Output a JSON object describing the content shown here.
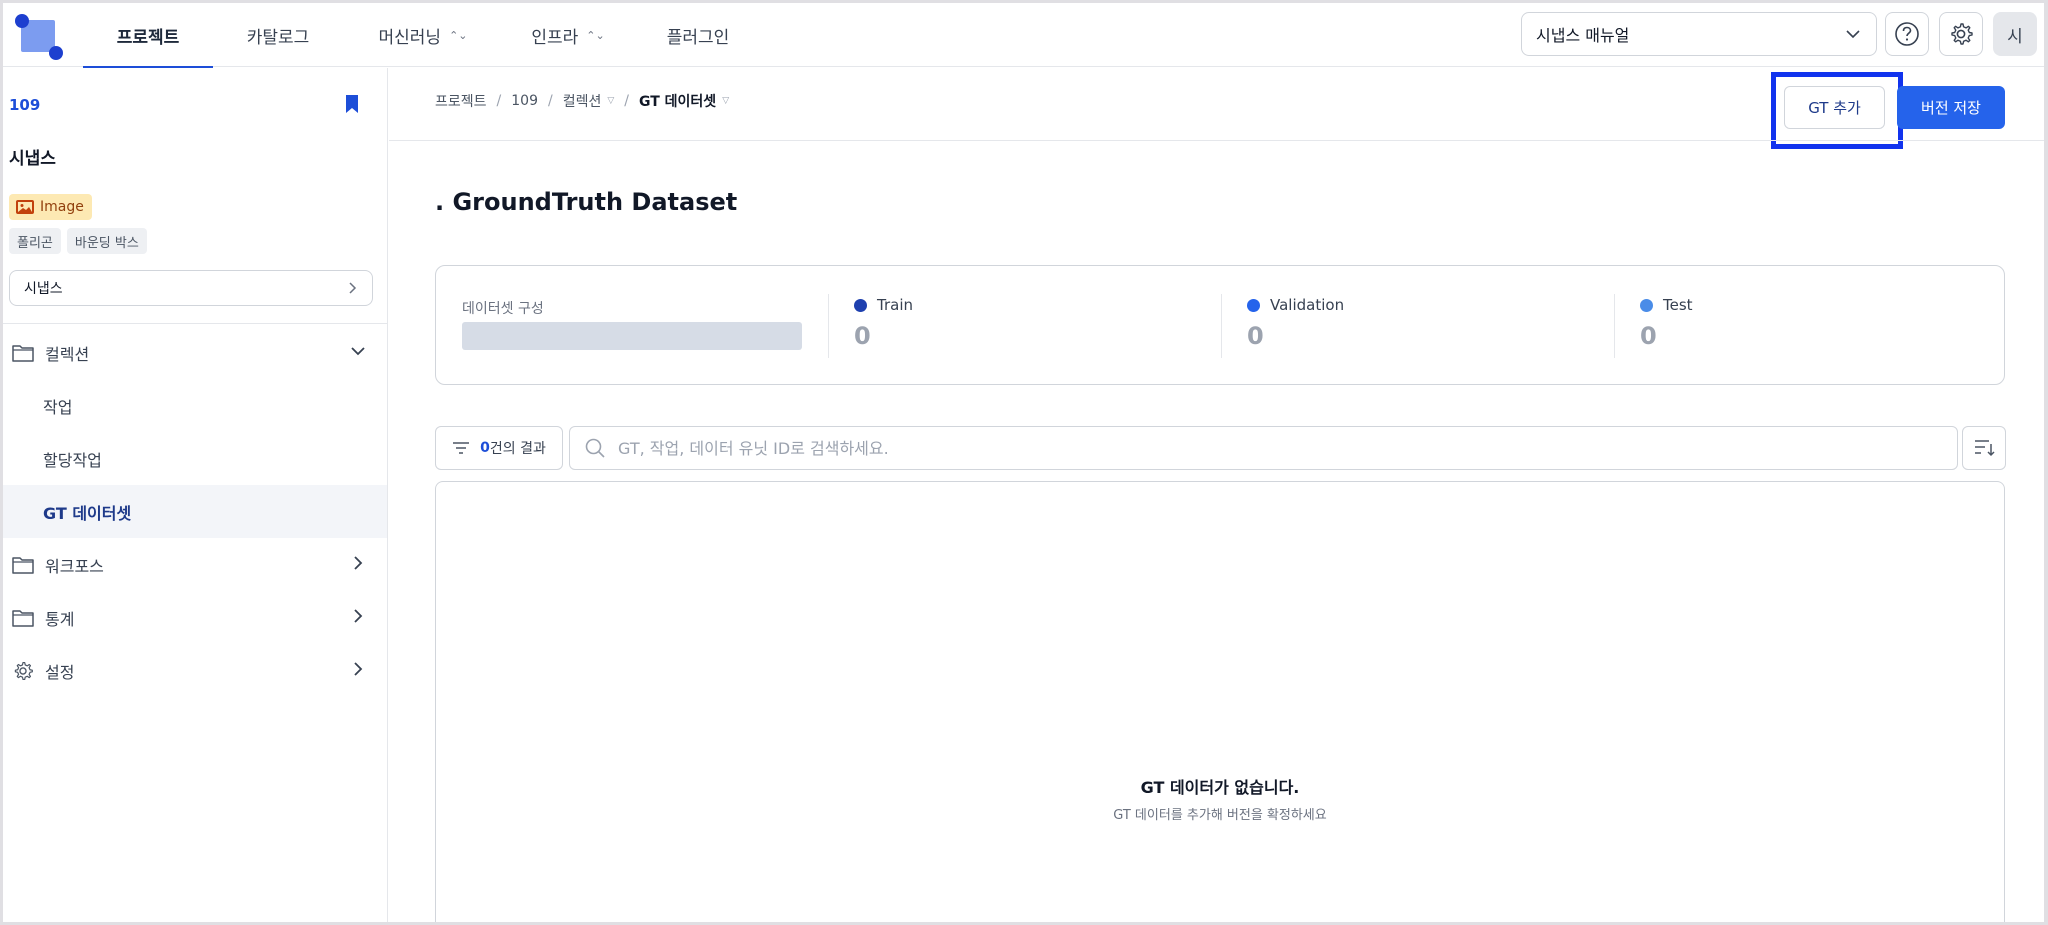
{
  "nav": {
    "items": [
      {
        "label": "프로젝트",
        "active": true,
        "dropdown": false
      },
      {
        "label": "카탈로그",
        "active": false,
        "dropdown": false
      },
      {
        "label": "머신러닝",
        "active": false,
        "dropdown": true
      },
      {
        "label": "인프라",
        "active": false,
        "dropdown": true
      },
      {
        "label": "플러그인",
        "active": false,
        "dropdown": false
      }
    ],
    "manual_select": "시냅스 매뉴얼",
    "avatar": "시"
  },
  "sidebar": {
    "project_id": "109",
    "project_name": "시냅스",
    "data_type": "Image",
    "annotation_tags": [
      "폴리곤",
      "바운딩 박스"
    ],
    "project_select": "시냅스",
    "menu": {
      "collection": "컬렉션",
      "task": "작업",
      "assignment": "할당작업",
      "gt_dataset": "GT 데이터셋",
      "workforce": "워크포스",
      "stats": "통계",
      "settings": "설정"
    }
  },
  "breadcrumb": {
    "items": [
      "프로젝트",
      "109",
      "컬렉션",
      "GT 데이터셋"
    ]
  },
  "actions": {
    "gt_add": "GT 추가",
    "save_version": "버전 저장"
  },
  "page": {
    "title": ". GroundTruth Dataset"
  },
  "dataset_stats": {
    "composition_label": "데이터셋 구성",
    "splits": [
      {
        "name": "Train",
        "value": "0",
        "color": "#1e40af"
      },
      {
        "name": "Validation",
        "value": "0",
        "color": "#2563eb"
      },
      {
        "name": "Test",
        "value": "0",
        "color": "#4a8ce8"
      }
    ]
  },
  "filter": {
    "count": "0",
    "suffix": "건의 결과"
  },
  "search": {
    "placeholder": "GT, 작업, 데이터 유닛 ID로 검색하세요."
  },
  "empty": {
    "title": "GT 데이터가 없습니다.",
    "subtitle": "GT 데이터를 추가해 버전을 확정하세요"
  },
  "colors": {
    "accent": "#2563eb",
    "highlight": "#1133ee"
  }
}
